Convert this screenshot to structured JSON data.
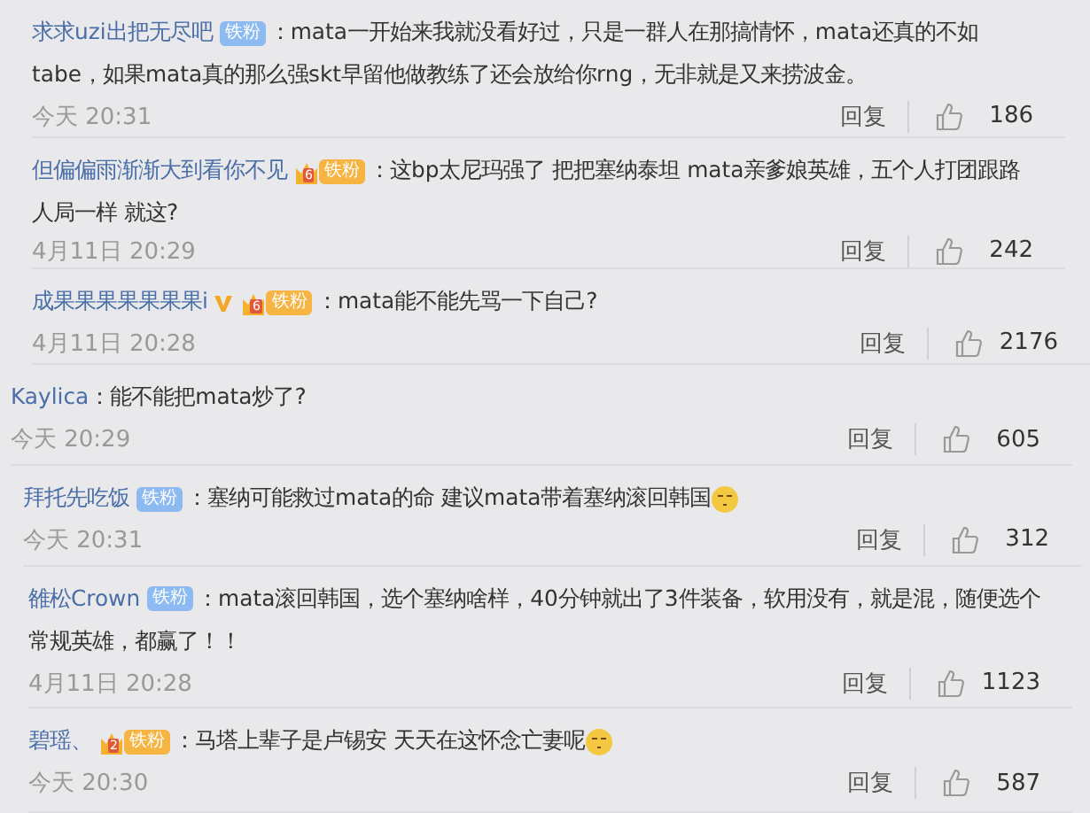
{
  "comments": [
    {
      "user": "求求uzi出把无尽吧",
      "verified": false,
      "badge": {
        "kind": "blue",
        "label": "铁粉"
      },
      "text": "：mata一开始来我就没看好过，只是一群人在那搞情怀，mata还真的不如tabe，如果mata真的那么强skt早留他做教练了还会放给你rng，无非就是又来捞波金。",
      "date": "今天 20:31",
      "reply": "回复",
      "likes": "186"
    },
    {
      "user": "但偏偏雨渐渐大到看你不见",
      "verified": false,
      "badge": {
        "kind": "gold",
        "level": "6",
        "label": "铁粉"
      },
      "text": "：这bp太尼玛强了 把把塞纳泰坦 mata亲爹娘英雄，五个人打团跟路人局一样 就这?",
      "date": "4月11日 20:29",
      "reply": "回复",
      "likes": "242"
    },
    {
      "user": "成果果果果果果果i",
      "verified": true,
      "badge": {
        "kind": "gold",
        "level": "6",
        "label": "铁粉"
      },
      "text": "：mata能不能先骂一下自己?",
      "date": "4月11日 20:28",
      "reply": "回复",
      "likes": "2176"
    },
    {
      "user": "Kaylica",
      "verified": false,
      "text": "：能不能把mata炒了?",
      "date": "今天 20:29",
      "reply": "回复",
      "likes": "605"
    },
    {
      "user": "拜托先吃饭",
      "verified": false,
      "badge": {
        "kind": "blue",
        "label": "铁粉"
      },
      "text": "：塞纳可能救过mata的命 建议mata带着塞纳滚回韩国",
      "emoji": true,
      "date": "今天 20:31",
      "reply": "回复",
      "likes": "312"
    },
    {
      "user": "雒松Crown",
      "verified": false,
      "badge": {
        "kind": "blue",
        "label": "铁粉"
      },
      "text": "：mata滚回韩国，选个塞纳啥样，40分钟就出了3件装备，软用没有，就是混，随便选个常规英雄，都赢了！！",
      "date": "4月11日 20:28",
      "reply": "回复",
      "likes": "1123"
    },
    {
      "user": "碧瑶、",
      "verified": false,
      "badge": {
        "kind": "gold",
        "level": "2",
        "label": "铁粉"
      },
      "text": "：马塔上辈子是卢锡安 天天在这怀念亡妻呢",
      "emoji": true,
      "date": "今天 20:30",
      "reply": "回复",
      "likes": "587"
    }
  ]
}
